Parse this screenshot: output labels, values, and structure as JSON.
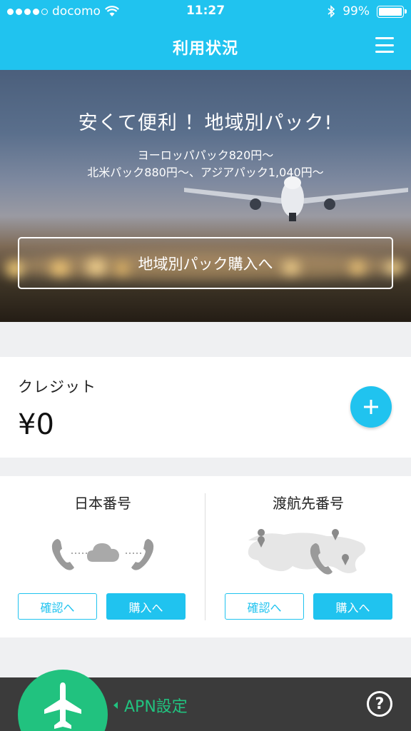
{
  "status_bar": {
    "carrier": "docomo",
    "time": "11:27",
    "battery": "99%",
    "signal_bars": 4
  },
  "nav": {
    "title": "利用状況",
    "menu_icon": "hamburger-menu-icon"
  },
  "banner": {
    "title": "安くて便利 ！地域別パック!",
    "subtitle_line1": "ヨーロッパパック820円〜",
    "subtitle_line2": "北米パック880円〜、アジアパック1,040円〜",
    "button_label": "地域別パック購入へ"
  },
  "credit": {
    "label": "クレジット",
    "value": "¥0",
    "add_icon": "plus-icon"
  },
  "japan_number": {
    "title": "日本番号",
    "confirm_label": "確認へ",
    "buy_label": "購入へ"
  },
  "travel_number": {
    "title": "渡航先番号",
    "confirm_label": "確認へ",
    "buy_label": "購入へ"
  },
  "bottom_bar": {
    "fab_icon": "airplane-icon",
    "apn_label": "APN設定",
    "help_label": "?"
  },
  "colors": {
    "accent": "#20c3ef",
    "fab_green": "#21c27f",
    "bottom_bar": "#3b3b3b"
  }
}
